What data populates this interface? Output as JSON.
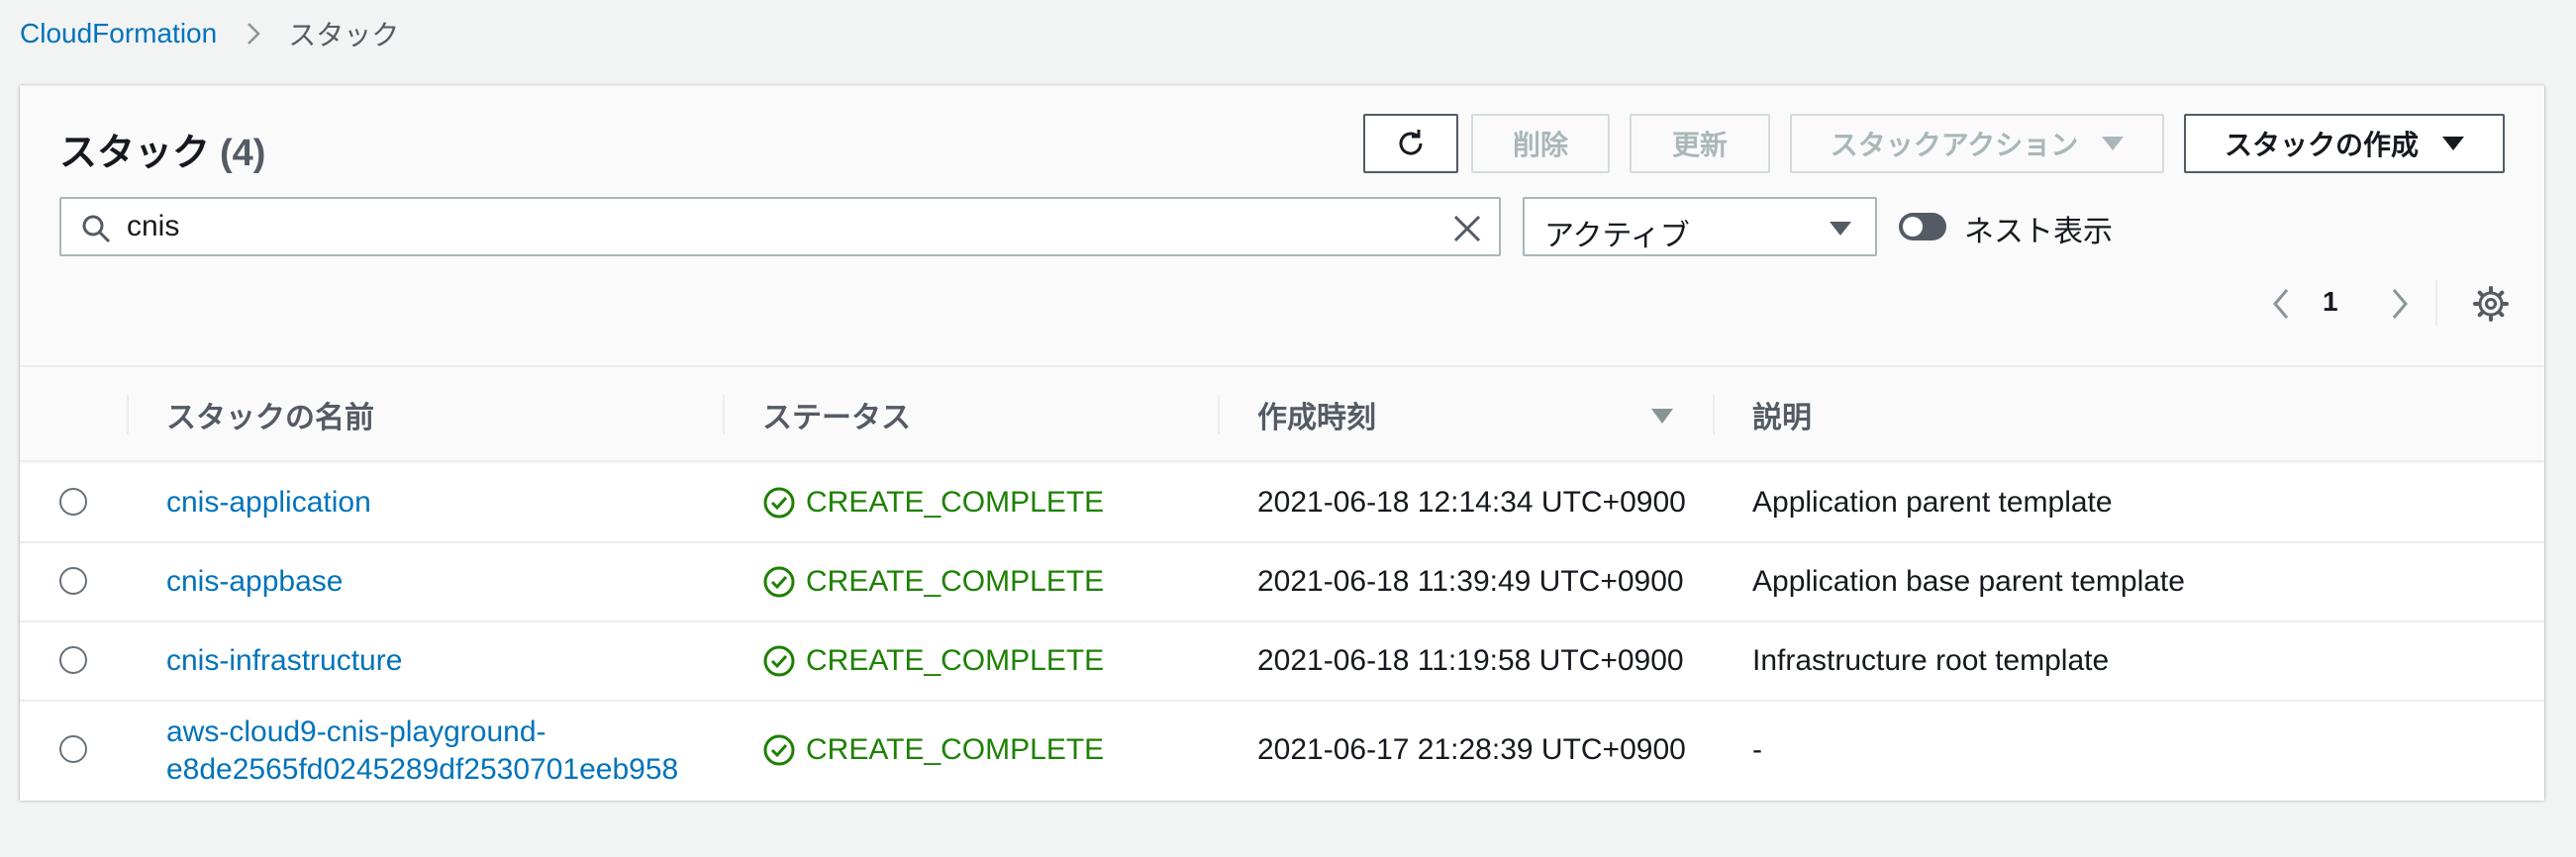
{
  "breadcrumb": {
    "root": "CloudFormation",
    "current": "スタック"
  },
  "panel": {
    "title": "スタック",
    "count": "(4)",
    "buttons": {
      "delete": "削除",
      "update": "更新",
      "stack_actions": "スタックアクション",
      "create_stack": "スタックの作成"
    },
    "search": {
      "value": "cnis",
      "placeholder": ""
    },
    "filter": {
      "selected": "アクティブ"
    },
    "nested_toggle": {
      "label": "ネスト表示",
      "on": false
    },
    "pagination": {
      "page": "1"
    }
  },
  "table": {
    "columns": [
      "スタックの名前",
      "ステータス",
      "作成時刻",
      "説明"
    ],
    "rows": [
      {
        "name": "cnis-application",
        "status": "CREATE_COMPLETE",
        "created": "2021-06-18 12:14:34 UTC+0900",
        "description": "Application parent template"
      },
      {
        "name": "cnis-appbase",
        "status": "CREATE_COMPLETE",
        "created": "2021-06-18 11:39:49 UTC+0900",
        "description": "Application base parent template"
      },
      {
        "name": "cnis-infrastructure",
        "status": "CREATE_COMPLETE",
        "created": "2021-06-18 11:19:58 UTC+0900",
        "description": "Infrastructure root template"
      },
      {
        "name_line1": "aws-cloud9-cnis-playground-",
        "name_line2": "e8de2565fd0245289df2530701eeb958",
        "status": "CREATE_COMPLETE",
        "created": "2021-06-17 21:28:39 UTC+0900",
        "description": "-"
      }
    ]
  },
  "colors": {
    "link": "#0073bb",
    "success": "#1d8102",
    "text": "#16191f",
    "muted": "#545b64"
  },
  "icons": [
    "chevron-right-icon",
    "refresh-icon",
    "search-icon",
    "clear-icon",
    "chevron-left-icon",
    "settings-icon",
    "status-success-icon"
  ]
}
